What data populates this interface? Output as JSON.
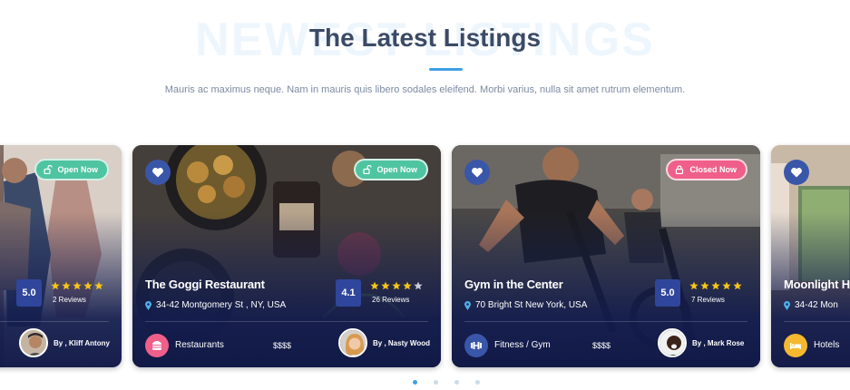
{
  "section": {
    "background_title": "NEWEST LISTINGS",
    "title": "The Latest Listings",
    "subtitle": "Mauris ac maximus neque. Nam in mauris quis libero sodales eleifend. Morbi varius, nulla sit amet rutrum elementum."
  },
  "listings": [
    {
      "status": "Open Now",
      "rating": "5.0",
      "reviews": "2 Reviews",
      "stars": 5,
      "author": "By , Kliff Antony"
    },
    {
      "name": "The Goggi Restaurant",
      "address": "34-42 Montgomery St , NY, USA",
      "status": "Open Now",
      "rating": "4.1",
      "reviews": "26 Reviews",
      "stars": 4,
      "category": "Restaurants",
      "category_color": "#ef5f8a",
      "price": "$$$$",
      "author": "By , Nasty Wood"
    },
    {
      "name": "Gym in the Center",
      "address": "70 Bright St New York, USA",
      "status": "Closed Now",
      "rating": "5.0",
      "reviews": "7 Reviews",
      "stars": 5,
      "category": "Fitness / Gym",
      "category_color": "#3a56a8",
      "price": "$$$$",
      "author": "By , Mark Rose"
    },
    {
      "name": "Moonlight Ho",
      "address": "34-42 Mon",
      "category": "Hotels",
      "category_color": "#f5b82e"
    }
  ],
  "colors": {
    "accent": "#3ea0e5",
    "rating_bg": "#30469c",
    "open": "#4fc4a0",
    "closed": "#ef5f8a",
    "star": "#f5c518"
  },
  "pagination": {
    "count": 4,
    "active": 1
  }
}
